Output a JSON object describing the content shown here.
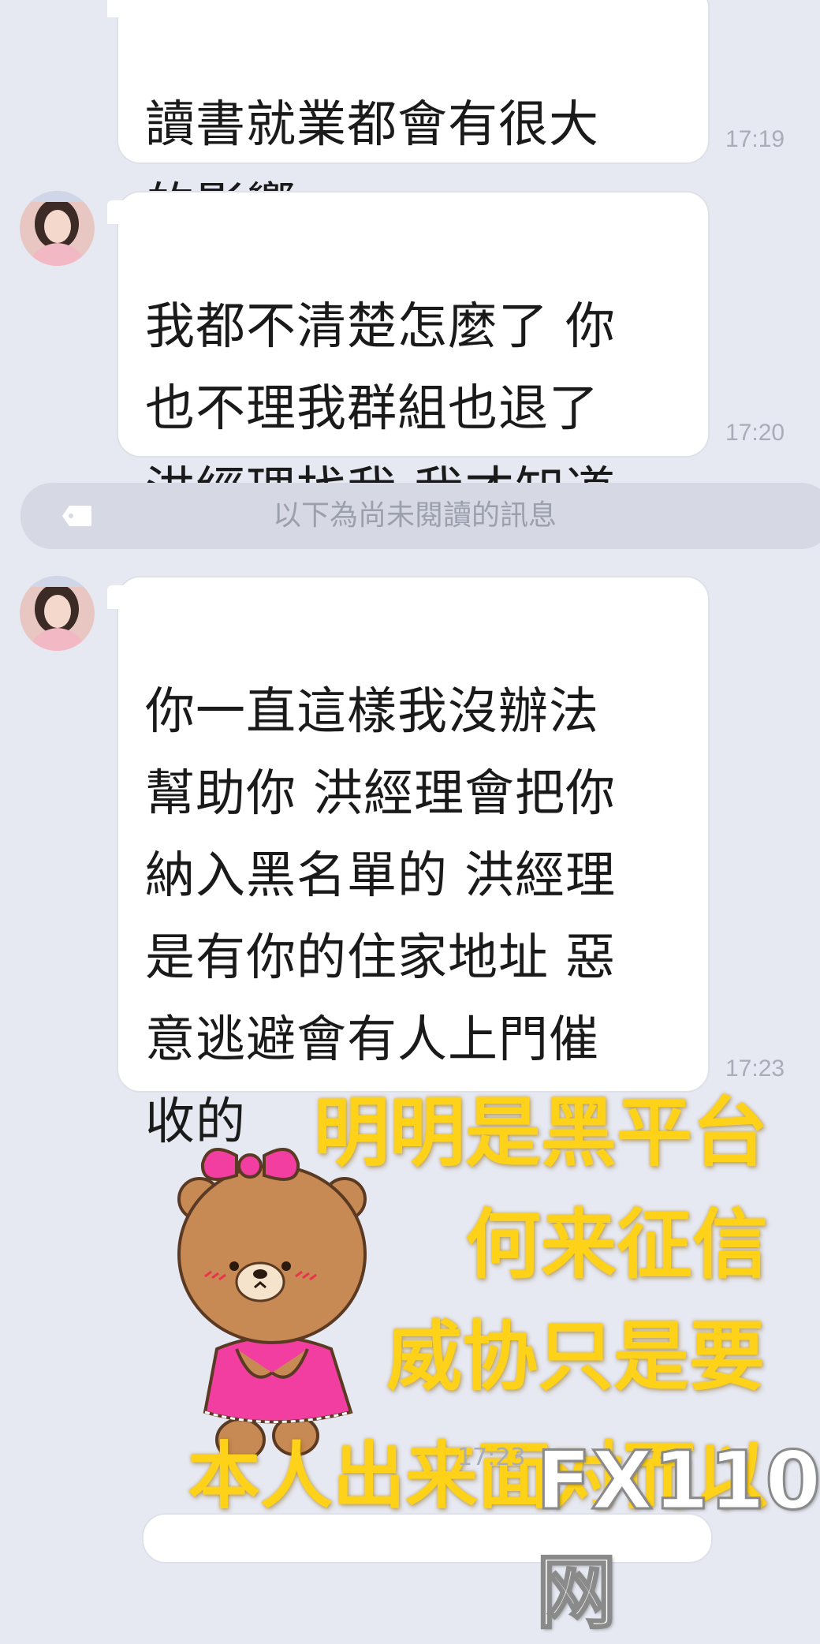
{
  "messages": [
    {
      "text": "讀書就業都會有很大\n的影響。",
      "time": "17:19"
    },
    {
      "text": "我都不清楚怎麼了 你\n也不理我群組也退了\n洪經理找我 我才知道",
      "time": "17:20"
    },
    {
      "text": "你一直這樣我沒辦法\n幫助你 洪經理會把你\n納入黑名單的 洪經理\n是有你的住家地址 惡\n意逃避會有人上門催\n收的",
      "time": "17:23"
    }
  ],
  "divider": {
    "label": "以下為尚未閱讀的訊息",
    "icon": "tag-icon"
  },
  "sticker": {
    "name": "brown-bear-with-pink-bow-sticker"
  },
  "overlay": {
    "lines": [
      "明明是黑平台",
      "何来征信",
      "威协只是要",
      "本人出来面对而以"
    ],
    "color": "#ffd21a"
  },
  "partial_time": "17:23",
  "watermark": {
    "text": "FX110网"
  }
}
